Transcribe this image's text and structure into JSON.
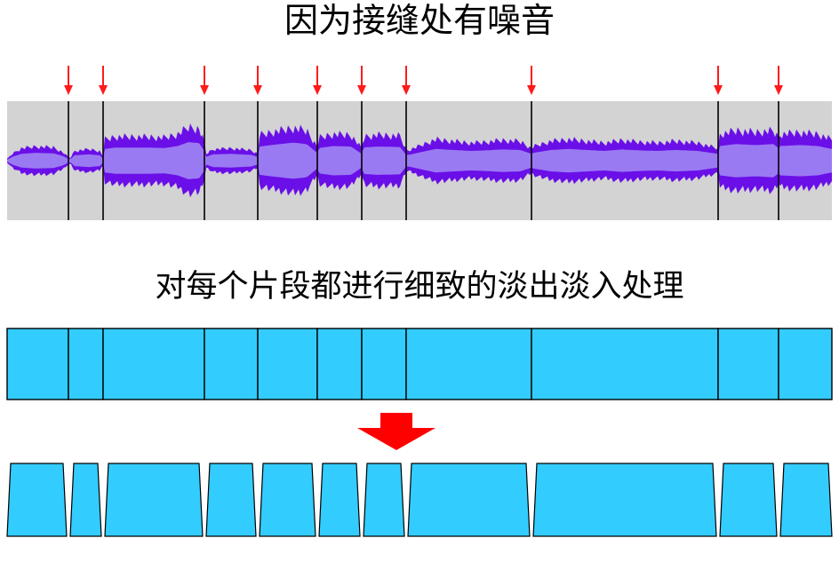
{
  "titles": {
    "top": "因为接缝处有噪音",
    "middle": "对每个片段都进行细致的淡出淡入处理"
  },
  "colors": {
    "text": "#000000",
    "seam_arrow": "#ff1a1a",
    "waveform_background": "#d3d3d3",
    "waveform_outer": "#6a0fe8",
    "waveform_inner": "#9a7af2",
    "seam_line": "#000000",
    "segment_fill": "#33ccff",
    "segment_stroke": "#000000",
    "process_arrow": "#ff0000"
  },
  "icons": {
    "seam_marker": "red-down-arrow-icon",
    "process": "big-red-down-arrow-icon"
  }
}
